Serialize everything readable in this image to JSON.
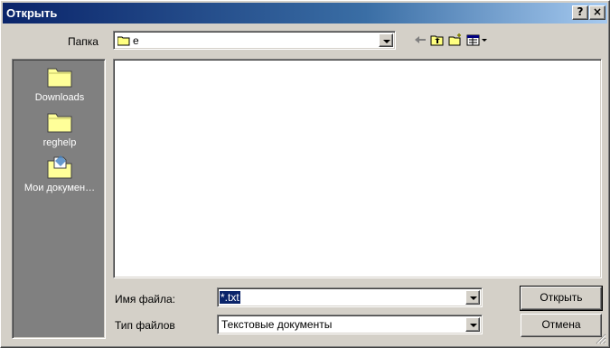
{
  "window": {
    "title": "Открыть",
    "help_button": "?",
    "close_button": "×"
  },
  "folder": {
    "label": "Папка",
    "current": "e"
  },
  "places": [
    {
      "label": "Downloads",
      "icon": "folder-icon"
    },
    {
      "label": "reghelp",
      "icon": "folder-icon"
    },
    {
      "label": "Мои докумен…",
      "icon": "my-documents-icon"
    }
  ],
  "file_name": {
    "label": "Имя файла:",
    "value": "*.txt"
  },
  "file_type": {
    "label": "Тип файлов",
    "value": "Текстовые документы"
  },
  "buttons": {
    "open": "Открыть",
    "cancel": "Отмена"
  },
  "colors": {
    "title_start": "#0a246a",
    "title_end": "#a6caf0",
    "face": "#d4d0c8",
    "places_bg": "#808080"
  }
}
